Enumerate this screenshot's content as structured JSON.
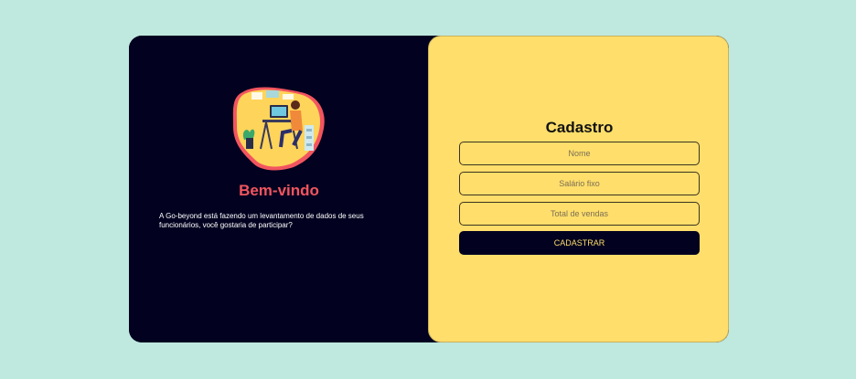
{
  "welcome": {
    "heading": "Bem-vindo",
    "text": "A Go-beyond está fazendo um levantamento de dados de seus funcionários, você gostaria de participar?",
    "illustration_icon": "person-at-computer-illustration"
  },
  "form": {
    "title": "Cadastro",
    "fields": [
      {
        "placeholder": "Nome",
        "value": ""
      },
      {
        "placeholder": "Salário fixo",
        "value": ""
      },
      {
        "placeholder": "Total de vendas",
        "value": ""
      }
    ],
    "submit_label": "CADASTRAR"
  },
  "colors": {
    "page_background": "#bfe8de",
    "dark_panel": "#020220",
    "yellow_panel": "#ffde6b",
    "accent_red": "#f2555f"
  }
}
